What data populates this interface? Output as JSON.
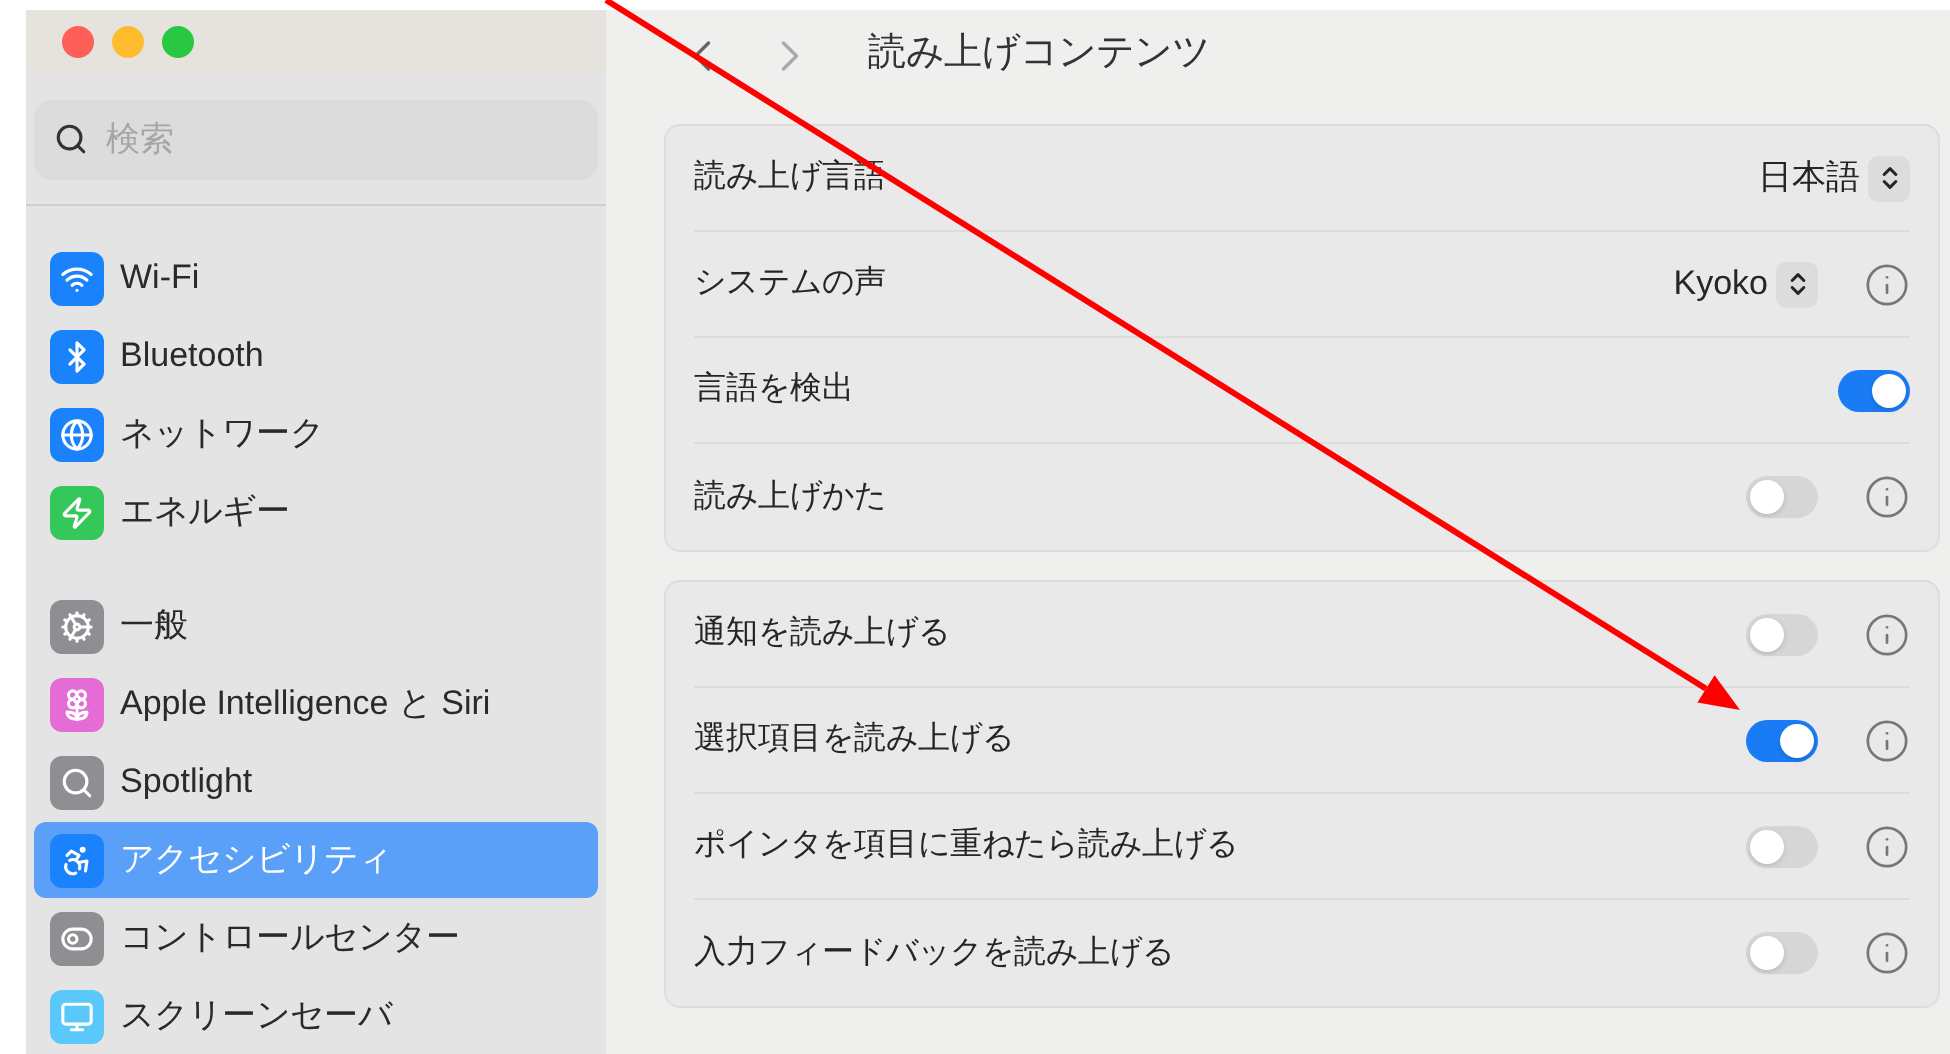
{
  "window": {
    "controls": [
      {
        "kind": "close"
      },
      {
        "kind": "minimize"
      },
      {
        "kind": "zoom"
      }
    ]
  },
  "sidebar": {
    "search": {
      "placeholder": "検索"
    },
    "groups": [
      [
        {
          "label": "Wi-Fi",
          "kind": "wifi",
          "color": "#1a82fb",
          "selected": false
        },
        {
          "label": "Bluetooth",
          "kind": "bluetooth",
          "color": "#1a82fb",
          "selected": false
        },
        {
          "label": "ネットワーク",
          "kind": "globe",
          "color": "#1a82fb",
          "selected": false
        },
        {
          "label": "エネルギー",
          "kind": "bolt",
          "color": "#34c759",
          "selected": false
        }
      ],
      [
        {
          "label": "一般",
          "kind": "gear",
          "color": "#8e8e93",
          "selected": false
        },
        {
          "label": "Apple Intelligence と Siri",
          "kind": "flower",
          "color": "#e56bd6",
          "selected": false
        },
        {
          "label": "Spotlight",
          "kind": "search",
          "color": "#8e8e93",
          "selected": false
        },
        {
          "label": "アクセシビリティ",
          "kind": "person",
          "color": "#1a82fb",
          "selected": true
        },
        {
          "label": "コントロールセンター",
          "kind": "switches",
          "color": "#8e8e93",
          "selected": false
        },
        {
          "label": "スクリーンセーバ",
          "kind": "screen",
          "color": "#5ac8fa",
          "selected": false
        }
      ]
    ]
  },
  "header": {
    "title": "読み上げコンテンツ"
  },
  "cards": [
    [
      {
        "kind": "popup",
        "label": "読み上げ言語",
        "value": "日本語",
        "info": false
      },
      {
        "kind": "popup",
        "label": "システムの声",
        "value": "Kyoko",
        "info": true
      },
      {
        "kind": "toggle",
        "label": "言語を検出",
        "on": true,
        "info": false
      },
      {
        "kind": "toggle",
        "label": "読み上げかた",
        "on": false,
        "info": true
      }
    ],
    [
      {
        "kind": "toggle",
        "label": "通知を読み上げる",
        "on": false,
        "info": true
      },
      {
        "kind": "toggle",
        "label": "選択項目を読み上げる",
        "on": true,
        "info": true
      },
      {
        "kind": "toggle",
        "label": "ポインタを項目に重ねたら読み上げる",
        "on": false,
        "info": true
      },
      {
        "kind": "toggle",
        "label": "入力フィードバックを読み上げる",
        "on": false,
        "info": true
      }
    ]
  ],
  "annotation": {
    "kind": "arrow",
    "color": "#ff0000"
  }
}
